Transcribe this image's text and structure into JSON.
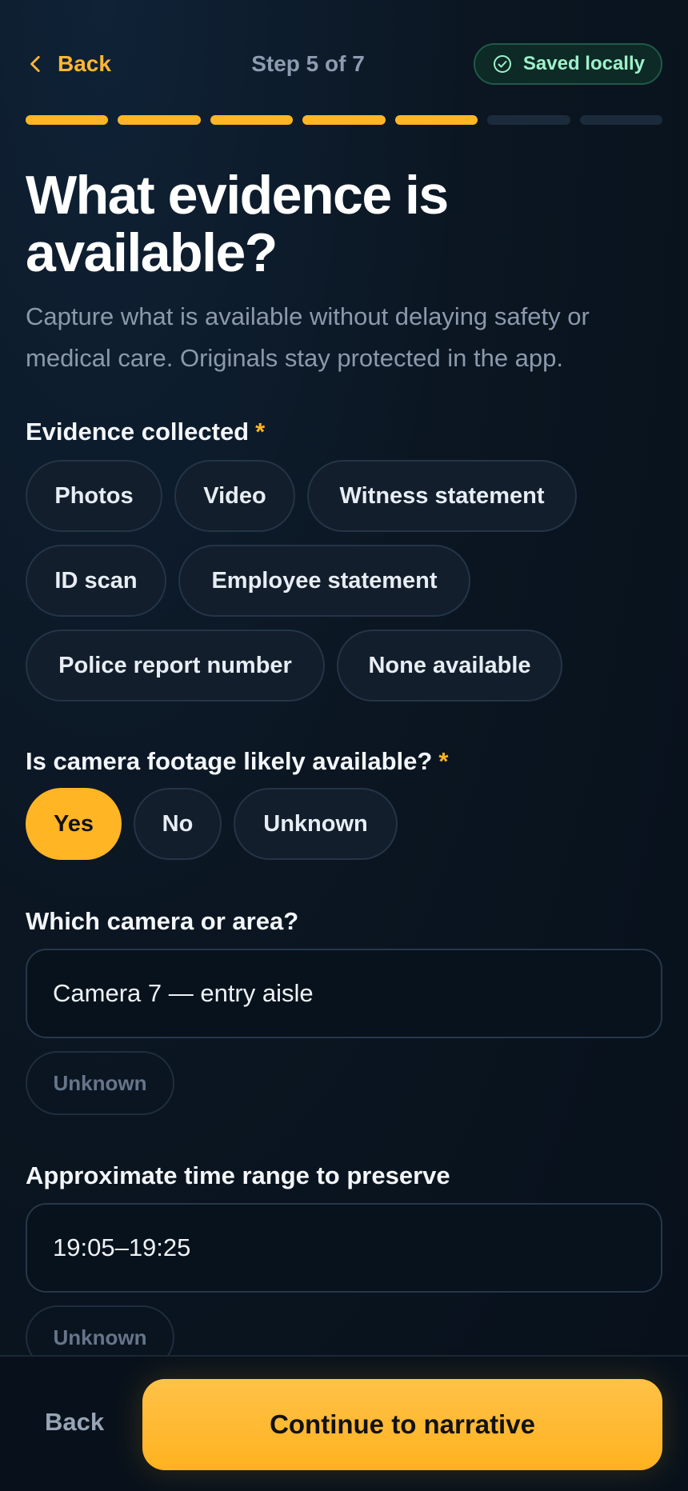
{
  "header": {
    "back_label": "Back",
    "step_label": "Step 5 of 7",
    "saved_label": "Saved locally"
  },
  "progress": {
    "current": 5,
    "total": 7,
    "accent_color": "#ffb524",
    "inactive_color": "#1c2b3b"
  },
  "title": "What evidence is available?",
  "subtitle": "Capture what is available without delaying safety or medical care. Originals stay protected in the app.",
  "evidence": {
    "label": "Evidence collected",
    "required_mark": "*",
    "options": [
      "Photos",
      "Video",
      "Witness statement",
      "ID scan",
      "Employee statement",
      "Police report number",
      "None available"
    ]
  },
  "camera_footage": {
    "label": "Is camera footage likely available?",
    "required_mark": "*",
    "options": [
      "Yes",
      "No",
      "Unknown"
    ],
    "selected": "Yes"
  },
  "camera_area": {
    "label": "Which camera or area?",
    "value": "Camera 7 — entry aisle",
    "unknown_label": "Unknown"
  },
  "time_range": {
    "label": "Approximate time range to preserve",
    "value": "19:05–19:25",
    "unknown_label": "Unknown"
  },
  "footer": {
    "back_label": "Back",
    "continue_label": "Continue to narrative"
  },
  "icons": {
    "back": "chevron-left-icon",
    "saved": "check-circle-icon"
  },
  "colors": {
    "accent": "#ffb524",
    "saved_text": "#9ff0cb"
  }
}
